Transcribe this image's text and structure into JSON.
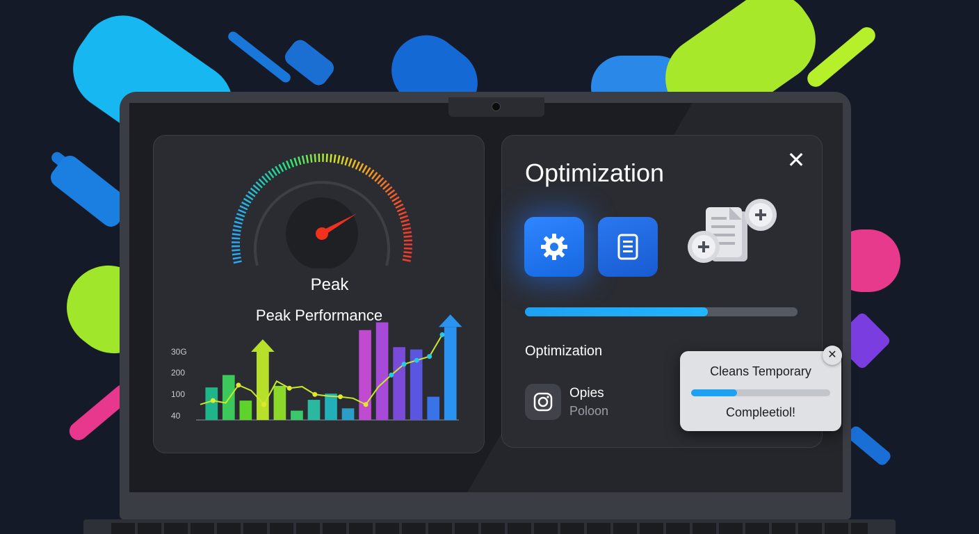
{
  "gauge": {
    "level": 0.75,
    "title": "Peak"
  },
  "chart_data": {
    "type": "bar",
    "title": "Peak Performance",
    "ytick_labels": [
      "40",
      "100",
      "200",
      "30G"
    ],
    "bar_values": [
      42,
      58,
      25,
      88,
      44,
      12,
      26,
      34,
      15,
      116,
      126,
      94,
      91,
      30,
      120
    ],
    "line_values": [
      20,
      25,
      22,
      45,
      38,
      20,
      50,
      41,
      43,
      33,
      31,
      30,
      28,
      20,
      43,
      58,
      72,
      77,
      82,
      110
    ]
  },
  "optimization": {
    "title": "Optimization",
    "close_glyph": "✕",
    "progress_fraction": 0.67,
    "subtitle": "Optimization",
    "item": {
      "title": "Opies",
      "subtitle": "Poloon"
    }
  },
  "toast": {
    "title": "Cleans Temporary",
    "progress_fraction": 0.33,
    "status": "Compleetiol!",
    "close_glyph": "✕"
  },
  "icons": {
    "tile1": "gear-icon",
    "tile2": "document-icon",
    "files": "add-files-icon",
    "item": "camera-icon"
  }
}
